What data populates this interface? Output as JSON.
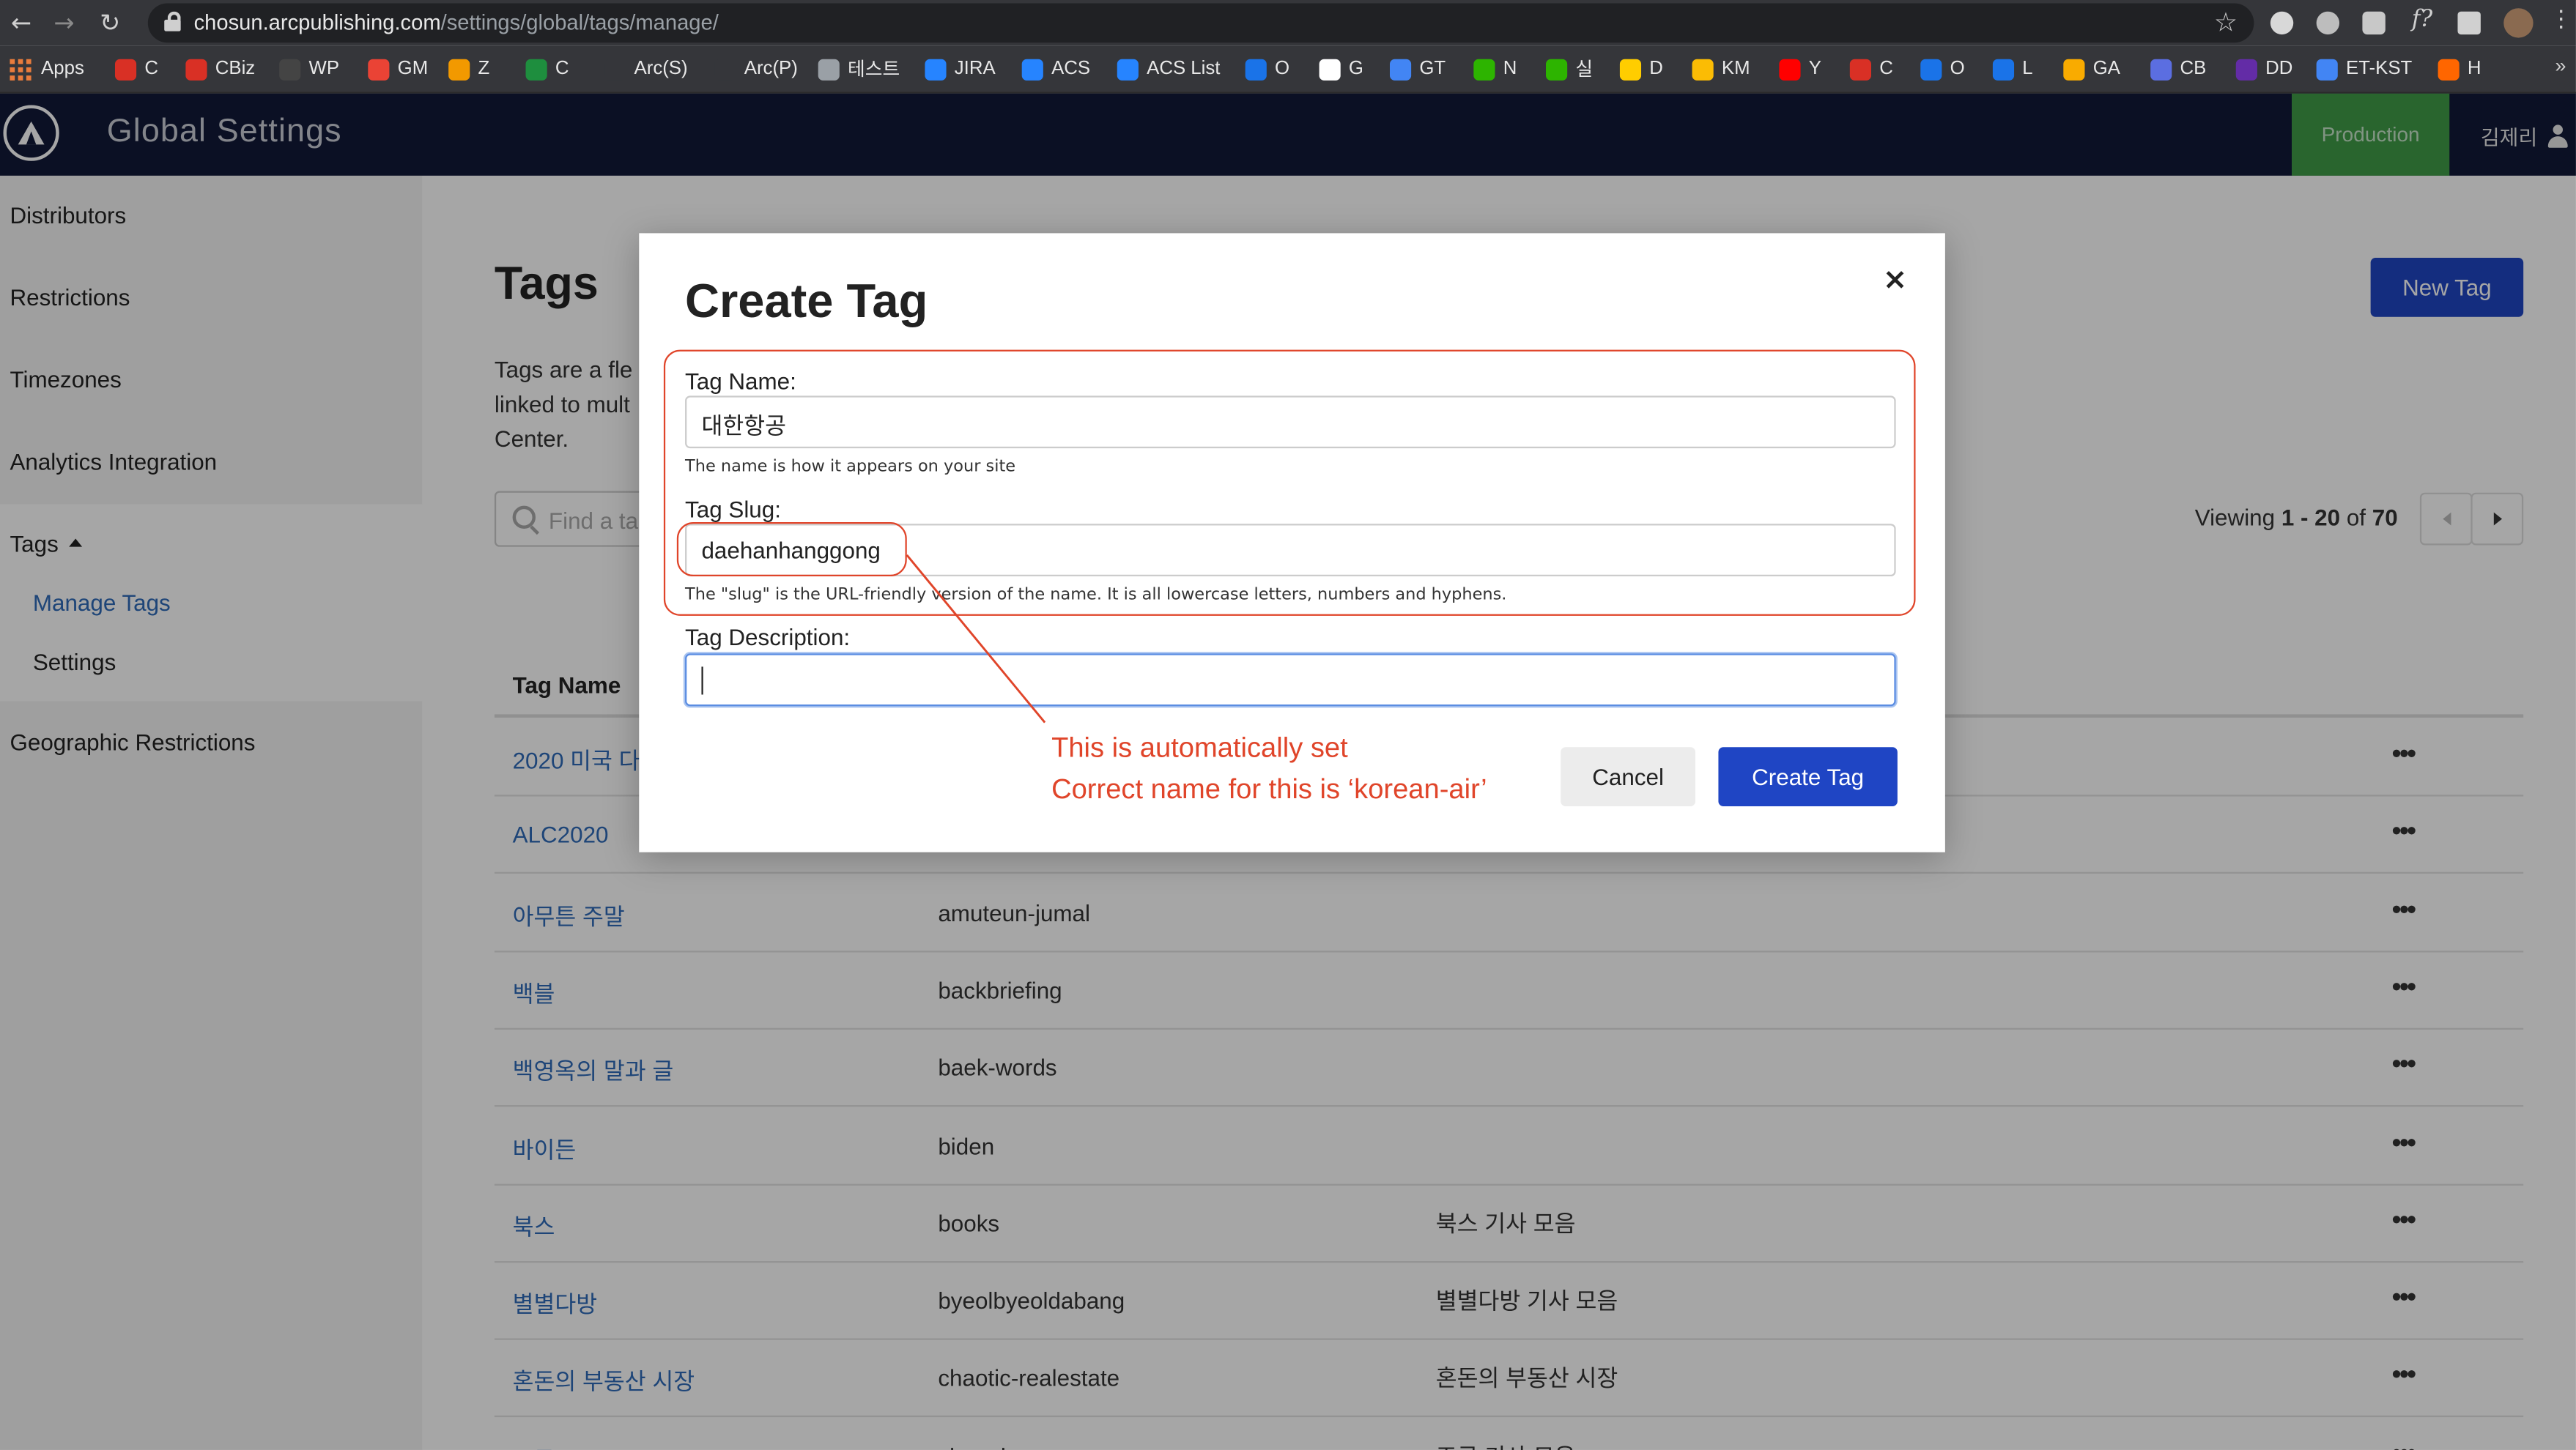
{
  "browser": {
    "url_host": "chosun.arcpublishing.com",
    "url_path": "/settings/global/tags/manage/",
    "bookmarks": [
      {
        "label": "Apps",
        "color": "#e97c3c"
      },
      {
        "label": "C",
        "color": "#d93025"
      },
      {
        "label": "CBiz",
        "color": "#d93025"
      },
      {
        "label": "WP",
        "color": "#444444"
      },
      {
        "label": "GM",
        "color": "#ea4335"
      },
      {
        "label": "Z",
        "color": "#f29900"
      },
      {
        "label": "C",
        "color": "#1e8e3e"
      },
      {
        "label": "Arc(S)",
        "color": "#35363a"
      },
      {
        "label": "Arc(P)",
        "color": "#35363a"
      },
      {
        "label": "테스트",
        "color": "#9aa0a6"
      },
      {
        "label": "JIRA",
        "color": "#2684ff"
      },
      {
        "label": "ACS",
        "color": "#2684ff"
      },
      {
        "label": "ACS List",
        "color": "#2684ff"
      },
      {
        "label": "O",
        "color": "#1a73e8"
      },
      {
        "label": "G",
        "color": "#ffffff"
      },
      {
        "label": "GT",
        "color": "#4285f4"
      },
      {
        "label": "N",
        "color": "#2db400"
      },
      {
        "label": "실",
        "color": "#2db400"
      },
      {
        "label": "D",
        "color": "#ffcd00"
      },
      {
        "label": "KM",
        "color": "#fbbc04"
      },
      {
        "label": "Y",
        "color": "#ff0000"
      },
      {
        "label": "C",
        "color": "#d93025"
      },
      {
        "label": "O",
        "color": "#1a73e8"
      },
      {
        "label": "L",
        "color": "#1a73e8"
      },
      {
        "label": "GA",
        "color": "#f9ab00"
      },
      {
        "label": "CB",
        "color": "#5b6ee1"
      },
      {
        "label": "DD",
        "color": "#632ca6"
      },
      {
        "label": "ET-KST",
        "color": "#4285f4"
      },
      {
        "label": "H",
        "color": "#ff6600"
      }
    ],
    "more": "»"
  },
  "header": {
    "title": "Global Settings",
    "environment": "Production",
    "user": "김제리"
  },
  "sidebar": {
    "items": [
      "Distributors",
      "Restrictions",
      "Timezones",
      "Analytics Integration"
    ],
    "tags_label": "Tags",
    "sub_items": [
      "Manage Tags",
      "Settings"
    ],
    "geo": "Geographic Restrictions"
  },
  "main": {
    "title": "Tags",
    "description": [
      "Tags are a fle",
      "linked to mult",
      "Center."
    ],
    "search_placeholder": "Find a ta",
    "new_tag": "New Tag",
    "viewing_prefix": "Viewing ",
    "viewing_range": "1 - 20",
    "viewing_of": " of ",
    "viewing_total": "70",
    "col_name": "Tag Name",
    "rows": [
      {
        "name": "2020 미국 다",
        "slug": "",
        "desc": ""
      },
      {
        "name": "ALC2020",
        "slug": "",
        "desc": ""
      },
      {
        "name": "아무튼 주말",
        "slug": "amuteun-jumal",
        "desc": ""
      },
      {
        "name": "백블",
        "slug": "backbriefing",
        "desc": ""
      },
      {
        "name": "백영옥의 말과 글",
        "slug": "baek-words",
        "desc": ""
      },
      {
        "name": "바이든",
        "slug": "biden",
        "desc": ""
      },
      {
        "name": "북스",
        "slug": "books",
        "desc": "북스 기사 모음"
      },
      {
        "name": "별별다방",
        "slug": "byeolbyeoldabang",
        "desc": "별별다방 기사 모음"
      },
      {
        "name": "혼돈의 부동산 시장",
        "slug": "chaotic-realestate",
        "desc": "혼돈의 부동산 시장"
      },
      {
        "name": "조국",
        "slug": "choguk",
        "desc": "조국 기사 모음"
      }
    ],
    "row_menu": "•••"
  },
  "modal": {
    "title": "Create Tag",
    "close": "×",
    "name_label": "Tag Name:",
    "name_value": "대한항공",
    "name_hint": "The name is how it appears on your site",
    "slug_label": "Tag Slug:",
    "slug_value": "daehanhanggong",
    "slug_hint": "The \"slug\" is the URL-friendly version of the name. It is all lowercase letters, numbers and hyphens.",
    "desc_label": "Tag Description:",
    "desc_value": "",
    "cancel": "Cancel",
    "create": "Create Tag"
  },
  "annotation": {
    "line1": "This is automatically set",
    "line2": "Correct name for this is ‘korean-air’",
    "color": "#e0452a"
  }
}
